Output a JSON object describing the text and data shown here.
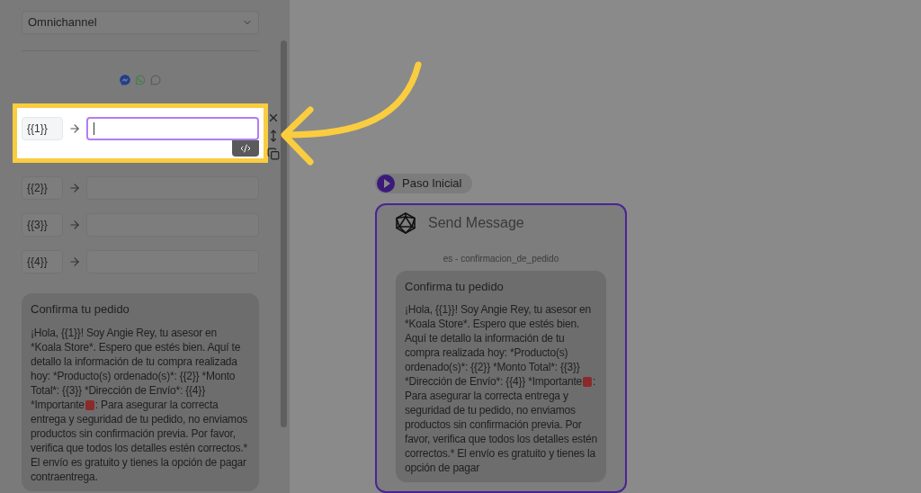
{
  "sidebar": {
    "channel_select": {
      "value": "Omnichannel"
    },
    "variables": [
      {
        "tag": "{{1}}",
        "highlighted": true,
        "focused": true
      },
      {
        "tag": "{{2}}",
        "highlighted": false,
        "focused": false
      },
      {
        "tag": "{{3}}",
        "highlighted": false,
        "focused": false
      },
      {
        "tag": "{{4}}",
        "highlighted": false,
        "focused": false
      }
    ],
    "preview": {
      "title": "Confirma tu pedido",
      "body_before": "¡Hola, {{1}}! Soy Angie Rey, tu asesor en *Koala Store*. Espero que estés bien. Aquí te detallo la información de tu compra realizada hoy: *Producto(s) ordenado(s)*: {{2}} *Monto Total*: {{3}} *Dirección de Envío*: {{4}} *Importante",
      "body_after": ": Para asegurar la correcta entrega y seguridad de tu pedido, no enviamos productos sin confirmación previa. Por favor, verifica que todos los detalles estén correctos.* El envío es gratuito y tienes la opción de pagar contraentrega."
    }
  },
  "canvas": {
    "start_node": {
      "label": "Paso Inicial"
    },
    "message_node": {
      "title": "Send Message",
      "template": "es - confirmacion_de_pedido",
      "selected": true,
      "preview": {
        "title": "Confirma tu pedido",
        "body_before": "¡Hola, {{1}}! Soy Angie Rey, tu asesor en *Koala Store*. Espero que estés bien. Aquí te detallo la información de tu compra realizada hoy: *Producto(s) ordenado(s)*: {{2}} *Monto Total*: {{3}} *Dirección de Envío*: {{4}} *Importante",
        "body_after": ": Para asegurar la correcta entrega y seguridad de tu pedido, no enviamos productos sin confirmación previa. Por favor, verifica que todos los detalles estén correctos.* El envío es gratuito y tienes la opción de pagar"
      }
    }
  }
}
